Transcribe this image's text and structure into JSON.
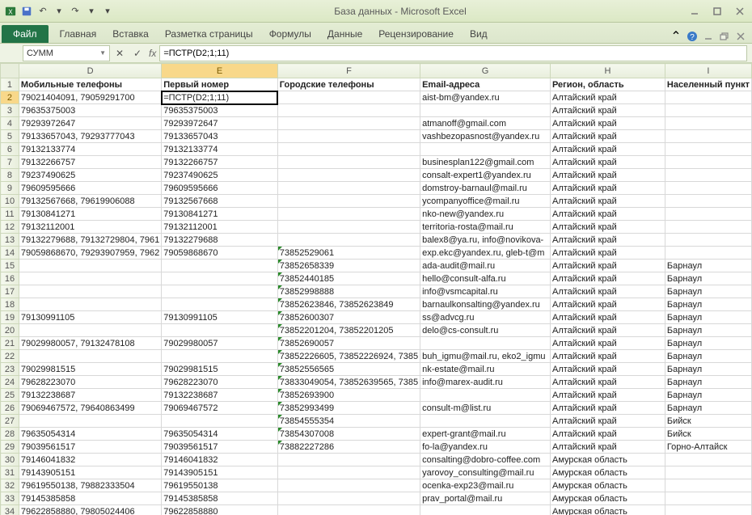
{
  "window": {
    "title": "База данных - Microsoft Excel"
  },
  "ribbon": {
    "file": "Файл",
    "tabs": [
      "Главная",
      "Вставка",
      "Разметка страницы",
      "Формулы",
      "Данные",
      "Рецензирование",
      "Вид"
    ]
  },
  "formulabar": {
    "namebox": "СУММ",
    "formula": "=ПСТР(D2;1;11)"
  },
  "columns": [
    "D",
    "E",
    "F",
    "G",
    "H",
    "I"
  ],
  "headers": {
    "D": "Мобильные телефоны",
    "E": "Первый номер",
    "F": "Городские телефоны",
    "G": "Email-адреса",
    "H": "Регион, область",
    "I": "Населенный пункт"
  },
  "selected_cell": "E2",
  "selected_col": "E",
  "selected_row": 2,
  "rows": [
    {
      "n": 2,
      "D": "79021404091, 79059291700",
      "E": "=ПСТР(D2;1;11)",
      "F": "",
      "G": "aist-bm@yandex.ru",
      "H": "Алтайский край",
      "I": ""
    },
    {
      "n": 3,
      "D": "79635375003",
      "E": "79635375003",
      "F": "",
      "G": "",
      "H": "Алтайский край",
      "I": ""
    },
    {
      "n": 4,
      "D": "79293972647",
      "E": "79293972647",
      "F": "",
      "G": "atmanoff@gmail.com",
      "H": "Алтайский край",
      "I": ""
    },
    {
      "n": 5,
      "D": "79133657043, 79293777043",
      "E": "79133657043",
      "F": "",
      "G": "vashbezopasnost@yandex.ru",
      "H": "Алтайский край",
      "I": ""
    },
    {
      "n": 6,
      "D": "79132133774",
      "E": "79132133774",
      "F": "",
      "G": "",
      "H": "Алтайский край",
      "I": ""
    },
    {
      "n": 7,
      "D": "79132266757",
      "E": "79132266757",
      "F": "",
      "G": "businesplan122@gmail.com",
      "H": "Алтайский край",
      "I": ""
    },
    {
      "n": 8,
      "D": "79237490625",
      "E": "79237490625",
      "F": "",
      "G": "consalt-expert1@yandex.ru",
      "H": "Алтайский край",
      "I": ""
    },
    {
      "n": 9,
      "D": "79609595666",
      "E": "79609595666",
      "F": "",
      "G": "domstroy-barnaul@mail.ru",
      "H": "Алтайский край",
      "I": ""
    },
    {
      "n": 10,
      "D": "79132567668, 79619906088",
      "E": "79132567668",
      "F": "",
      "G": "ycompanyoffice@mail.ru",
      "H": "Алтайский край",
      "I": ""
    },
    {
      "n": 11,
      "D": "79130841271",
      "E": "79130841271",
      "F": "",
      "G": "nko-new@yandex.ru",
      "H": "Алтайский край",
      "I": ""
    },
    {
      "n": 12,
      "D": "79132112001",
      "E": "79132112001",
      "F": "",
      "G": "territoria-rosta@mail.ru",
      "H": "Алтайский край",
      "I": ""
    },
    {
      "n": 13,
      "D": "79132279688, 79132729804, 7961",
      "E": "79132279688",
      "F": "",
      "G": "balex8@ya.ru, info@novikova-",
      "H": "Алтайский край",
      "I": ""
    },
    {
      "n": 14,
      "D": "79059868670, 79293907959, 7962",
      "E": "79059868670",
      "F": "73852529061",
      "G": "exp.ekc@yandex.ru, gleb-t@m",
      "H": "Алтайский край",
      "I": ""
    },
    {
      "n": 15,
      "D": "",
      "E": "",
      "F": "73852658339",
      "G": "ada-audit@mail.ru",
      "H": "Алтайский край",
      "I": "Барнаул"
    },
    {
      "n": 16,
      "D": "",
      "E": "",
      "F": "73852440185",
      "G": "hello@consult-alfa.ru",
      "H": "Алтайский край",
      "I": "Барнаул"
    },
    {
      "n": 17,
      "D": "",
      "E": "",
      "F": "73852998888",
      "G": "info@vsmcapital.ru",
      "H": "Алтайский край",
      "I": "Барнаул"
    },
    {
      "n": 18,
      "D": "",
      "E": "",
      "F": "73852623846, 73852623849",
      "G": "barnaulkonsalting@yandex.ru",
      "H": "Алтайский край",
      "I": "Барнаул"
    },
    {
      "n": 19,
      "D": "79130991105",
      "E": "79130991105",
      "F": "73852600307",
      "G": "ss@advcg.ru",
      "H": "Алтайский край",
      "I": "Барнаул"
    },
    {
      "n": 20,
      "D": "",
      "E": "",
      "F": "73852201204, 73852201205",
      "G": "delo@cs-consult.ru",
      "H": "Алтайский край",
      "I": "Барнаул"
    },
    {
      "n": 21,
      "D": "79029980057, 79132478108",
      "E": "79029980057",
      "F": "73852690057",
      "G": "",
      "H": "Алтайский край",
      "I": "Барнаул"
    },
    {
      "n": 22,
      "D": "",
      "E": "",
      "F": "73852226605, 73852226924, 7385",
      "G": "buh_igmu@mail.ru, eko2_igmu",
      "H": "Алтайский край",
      "I": "Барнаул"
    },
    {
      "n": 23,
      "D": "79029981515",
      "E": "79029981515",
      "F": "73852556565",
      "G": "nk-estate@mail.ru",
      "H": "Алтайский край",
      "I": "Барнаул"
    },
    {
      "n": 24,
      "D": "79628223070",
      "E": "79628223070",
      "F": "73833049054, 73852639565, 7385",
      "G": "info@marex-audit.ru",
      "H": "Алтайский край",
      "I": "Барнаул"
    },
    {
      "n": 25,
      "D": "79132238687",
      "E": "79132238687",
      "F": "73852693900",
      "G": "",
      "H": "Алтайский край",
      "I": "Барнаул"
    },
    {
      "n": 26,
      "D": "79069467572, 79640863499",
      "E": "79069467572",
      "F": "73852993499",
      "G": "consult-m@list.ru",
      "H": "Алтайский край",
      "I": "Барнаул"
    },
    {
      "n": 27,
      "D": "",
      "E": "",
      "F": "73854555354",
      "G": "",
      "H": "Алтайский край",
      "I": "Бийск"
    },
    {
      "n": 28,
      "D": "79635054314",
      "E": "79635054314",
      "F": "73854307008",
      "G": "expert-grant@mail.ru",
      "H": "Алтайский край",
      "I": "Бийск"
    },
    {
      "n": 29,
      "D": "79039561517",
      "E": "79039561517",
      "F": "73882227286",
      "G": "fo-la@yandex.ru",
      "H": "Алтайский край",
      "I": "Горно-Алтайск"
    },
    {
      "n": 30,
      "D": "79146041832",
      "E": "79146041832",
      "F": "",
      "G": "consalting@dobro-coffee.com",
      "H": "Амурская область",
      "I": ""
    },
    {
      "n": 31,
      "D": "79143905151",
      "E": "79143905151",
      "F": "",
      "G": "yarovoy_consulting@mail.ru",
      "H": "Амурская область",
      "I": ""
    },
    {
      "n": 32,
      "D": "79619550138, 79882333504",
      "E": "79619550138",
      "F": "",
      "G": "ocenka-exp23@mail.ru",
      "H": "Амурская область",
      "I": ""
    },
    {
      "n": 33,
      "D": "79145385858",
      "E": "79145385858",
      "F": "",
      "G": "prav_portal@mail.ru",
      "H": "Амурская область",
      "I": ""
    },
    {
      "n": 34,
      "D": "79622858880, 79805024406",
      "E": "79622858880",
      "F": "",
      "G": "",
      "H": "Амурская область",
      "I": ""
    }
  ]
}
